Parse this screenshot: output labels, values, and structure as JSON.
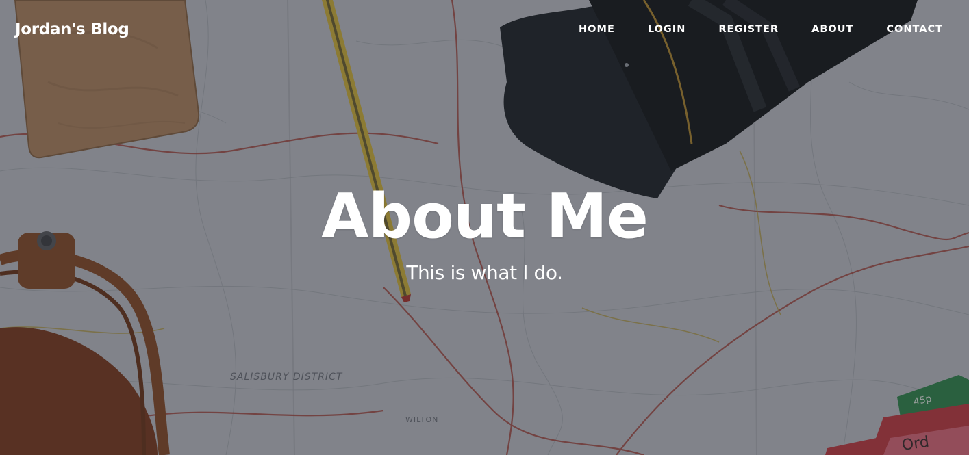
{
  "navbar": {
    "brand": "Jordan's Blog",
    "links": [
      {
        "label": "HOME"
      },
      {
        "label": "LOGIN"
      },
      {
        "label": "REGISTER"
      },
      {
        "label": "ABOUT"
      },
      {
        "label": "CONTACT"
      }
    ]
  },
  "hero": {
    "title": "About Me",
    "subtitle": "This is what I do.",
    "background": {
      "description_name": "map-with-camera-lens-pencil-notebook-bag",
      "overlay_color": "#23262e"
    },
    "map_labels": [
      "SALISBURY DISTRICT",
      "WILTON"
    ]
  },
  "colors": {
    "text": "#ffffff",
    "map_paper": "#c9ccd2",
    "road_red": "#a8453c",
    "notebook_wood": "#b88a63",
    "bag_leather": "#8a3f1f"
  }
}
